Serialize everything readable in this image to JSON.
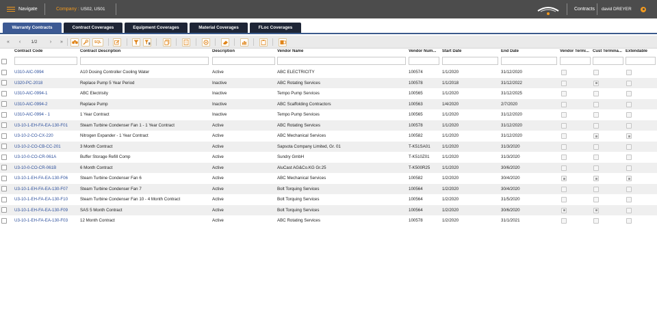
{
  "topbar": {
    "navigate_label": "Navigate",
    "company_label": "Company :",
    "company_value": "US02, US01",
    "module_label": "Contracts",
    "user_name": "david DREYER"
  },
  "tabs": [
    {
      "label": "Warranty Contracts",
      "active": true
    },
    {
      "label": "Contract Coverages",
      "active": false
    },
    {
      "label": "Equipment Coverages",
      "active": false
    },
    {
      "label": "Material Coverages",
      "active": false
    },
    {
      "label": "FLoc Coverages",
      "active": false
    }
  ],
  "toolbar": {
    "page_indicator": "1/2",
    "first_glyph": "«",
    "prev_glyph": "‹",
    "next_glyph": "›",
    "last_glyph": "»",
    "sql_label": "SQL"
  },
  "columns": {
    "code": "Contract Code",
    "desc": "Contract Description",
    "status": "Description",
    "vendor": "Vendor Name",
    "vnum": "Vendor Num...",
    "start": "Start Date",
    "end": "End Date",
    "vterm": "Vendor Termi...",
    "cterm": "Cust Termina...",
    "ext": "Extendable"
  },
  "rows": [
    {
      "code": "U310-AIC-0994",
      "desc": "A10 Dosing Controller Cooling Water",
      "status": "Active",
      "vendor": "ABC ELECTRICITY",
      "vnum": "100574",
      "start": "1/1/2020",
      "end": "31/12/2020",
      "vterm": false,
      "cterm": false,
      "ext": false
    },
    {
      "code": "U320-PC-2018",
      "desc": "Replace Pump 5 Year Period",
      "status": "Inactive",
      "vendor": "ABC Rotating Services",
      "vnum": "100578",
      "start": "1/1/2018",
      "end": "31/12/2022",
      "vterm": false,
      "cterm": true,
      "ext": false
    },
    {
      "code": "U310-AIC-0994-1",
      "desc": "ABC Electrisity",
      "status": "Inactive",
      "vendor": "Tempo Pump Services",
      "vnum": "100565",
      "start": "1/1/2020",
      "end": "31/12/2025",
      "vterm": false,
      "cterm": false,
      "ext": false
    },
    {
      "code": "U310-AIC-0994-2",
      "desc": "Replace Pump",
      "status": "Inactive",
      "vendor": "ABC Scaffolding Contractors",
      "vnum": "100563",
      "start": "1/4/2020",
      "end": "2/7/2020",
      "vterm": false,
      "cterm": false,
      "ext": false
    },
    {
      "code": "U310-AIC-0994 - 1",
      "desc": "1 Year Contract",
      "status": "Inactive",
      "vendor": "Tempo Pump Services",
      "vnum": "100565",
      "start": "1/1/2020",
      "end": "31/12/2020",
      "vterm": false,
      "cterm": false,
      "ext": false
    },
    {
      "code": "U3-10-1-EH-FA-EA-130-F01",
      "desc": "Steam Turbine Condenser Fan 1 - 1 Year Contract",
      "status": "Active",
      "vendor": "ABC Rotating Services",
      "vnum": "100578",
      "start": "1/1/2020",
      "end": "31/12/2020",
      "vterm": false,
      "cterm": false,
      "ext": false
    },
    {
      "code": "U3-10-2-CO-CX-220",
      "desc": "Nitrogen Expander - 1 Year Contract",
      "status": "Active",
      "vendor": "ABC Mechanical Services",
      "vnum": "100582",
      "start": "1/1/2020",
      "end": "31/12/2020",
      "vterm": false,
      "cterm": true,
      "ext": true
    },
    {
      "code": "U3-10-2-CO-CB-CC-201",
      "desc": "3 Month Contract",
      "status": "Active",
      "vendor": "Sapsota Company Limited, Gr. 01",
      "vnum": "T-K51SA01",
      "start": "1/1/2020",
      "end": "31/3/2020",
      "vterm": false,
      "cterm": false,
      "ext": false
    },
    {
      "code": "U3-10-0-CO-CR-061A",
      "desc": "Buffer Storage Refill Comp",
      "status": "Active",
      "vendor": "Sundry GmbH",
      "vnum": "T-K510Z01",
      "start": "1/1/2020",
      "end": "31/3/2020",
      "vterm": false,
      "cterm": false,
      "ext": false
    },
    {
      "code": "U3-10-0-CO-CR-061B",
      "desc": "6 Month Contract",
      "status": "Active",
      "vendor": "AluCast AG&Co.KG Gr.25",
      "vnum": "T-K500R25",
      "start": "1/1/2020",
      "end": "30/6/2020",
      "vterm": false,
      "cterm": false,
      "ext": false
    },
    {
      "code": "U3-10-1-EH-FA-EA-130-F06",
      "desc": "Steam Turbine Condenser Fan 6",
      "status": "Active",
      "vendor": "ABC Mechanical Services",
      "vnum": "100582",
      "start": "1/2/2020",
      "end": "30/4/2020",
      "vterm": true,
      "cterm": true,
      "ext": true
    },
    {
      "code": "U3-10-1-EH-FA-EA-130-F07",
      "desc": "Steam Turbine Condenser Fan 7",
      "status": "Active",
      "vendor": "Bolt Torquing Services",
      "vnum": "100564",
      "start": "1/2/2020",
      "end": "30/4/2020",
      "vterm": false,
      "cterm": false,
      "ext": false
    },
    {
      "code": "U3-10-1-EH-FA-EA-130-F10",
      "desc": "Steam Turbine Condenser Fan 10 - 4 Month Contract",
      "status": "Active",
      "vendor": "Bolt Torquing Services",
      "vnum": "100564",
      "start": "1/2/2020",
      "end": "31/5/2020",
      "vterm": false,
      "cterm": false,
      "ext": false
    },
    {
      "code": "U3-10-1-EH-FA-EA-130-F09",
      "desc": "SAS 5 Month Contract",
      "status": "Active",
      "vendor": "Bolt Torquing Services",
      "vnum": "100564",
      "start": "1/2/2020",
      "end": "30/6/2020",
      "vterm": true,
      "cterm": true,
      "ext": false
    },
    {
      "code": "U3-10-1-EH-FA-EA-130-F03",
      "desc": "12 Month Contract",
      "status": "Active",
      "vendor": "ABC Rotating Services",
      "vnum": "100578",
      "start": "1/2/2020",
      "end": "31/1/2021",
      "vterm": false,
      "cterm": false,
      "ext": false
    }
  ],
  "colors": {
    "accent": "#f39a1e",
    "topbar": "#4c4c4c",
    "tab_active": "#3d5a94",
    "tab_inactive": "#1e2536",
    "link": "#2c4f9c"
  }
}
